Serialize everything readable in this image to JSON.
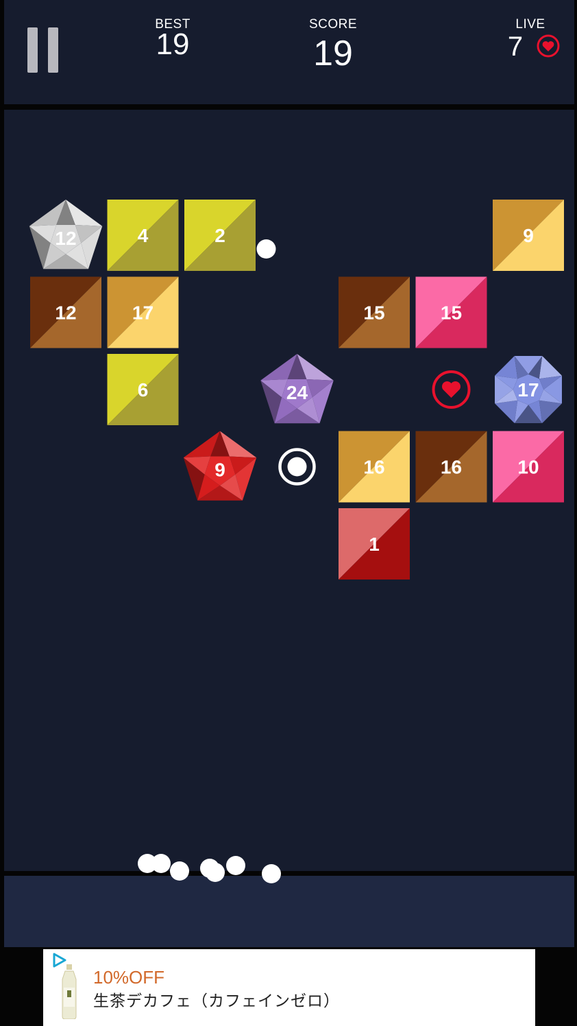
{
  "hud": {
    "best_label": "BEST",
    "best_value": "19",
    "score_label": "SCORE",
    "score_value": "19",
    "live_label": "LIVE",
    "live_value": "7",
    "pause_icon": "pause-icon",
    "heart_icon": "heart-icon"
  },
  "board": {
    "rows": [
      [
        {
          "shape": "pentagon",
          "hits": "12",
          "color": "#d8d8d8"
        },
        {
          "shape": "square",
          "hits": "4",
          "color": "#d4d12d"
        },
        {
          "shape": "square",
          "hits": "2",
          "color": "#d4d12d"
        },
        {
          "shape": "ball"
        },
        null,
        null,
        {
          "shape": "square",
          "hits": "9",
          "color": "#e8a83a"
        }
      ],
      [
        {
          "shape": "square",
          "hits": "12",
          "color": "#7a4018"
        },
        {
          "shape": "square",
          "hits": "17",
          "color": "#e8a83a"
        },
        null,
        null,
        {
          "shape": "square",
          "hits": "15",
          "color": "#7a4018"
        },
        {
          "shape": "square",
          "hits": "15",
          "color": "#f0558e"
        },
        null
      ],
      [
        null,
        {
          "shape": "square",
          "hits": "6",
          "color": "#d4d12d"
        },
        null,
        {
          "shape": "pentagon",
          "hits": "24",
          "color": "#9a72c8"
        },
        null,
        {
          "shape": "extra-life",
          "icon": "heart-ring-icon"
        },
        {
          "shape": "octagon",
          "hits": "17",
          "color": "#7c8ce0"
        }
      ],
      [
        null,
        null,
        {
          "shape": "pentagon",
          "hits": "9",
          "color": "#e01e1e"
        },
        {
          "shape": "extra-ball",
          "icon": "target-ring-icon"
        },
        {
          "shape": "square",
          "hits": "16",
          "color": "#e8a83a"
        },
        {
          "shape": "square",
          "hits": "16",
          "color": "#7a4018"
        },
        {
          "shape": "square",
          "hits": "10",
          "color": "#f0558e"
        }
      ],
      [
        null,
        null,
        null,
        null,
        {
          "shape": "square",
          "hits": "1",
          "color": "#c83c3c"
        },
        null,
        null
      ]
    ]
  },
  "launcher": {
    "ball_count": 7
  },
  "ad": {
    "discount_text": "10%OFF",
    "product_text": "生茶デカフェ（カフェインゼロ）",
    "logo_icon": "ad-choices-icon",
    "bottle_icon": "tea-bottle-image",
    "close_icon": "ad-info-icon"
  }
}
